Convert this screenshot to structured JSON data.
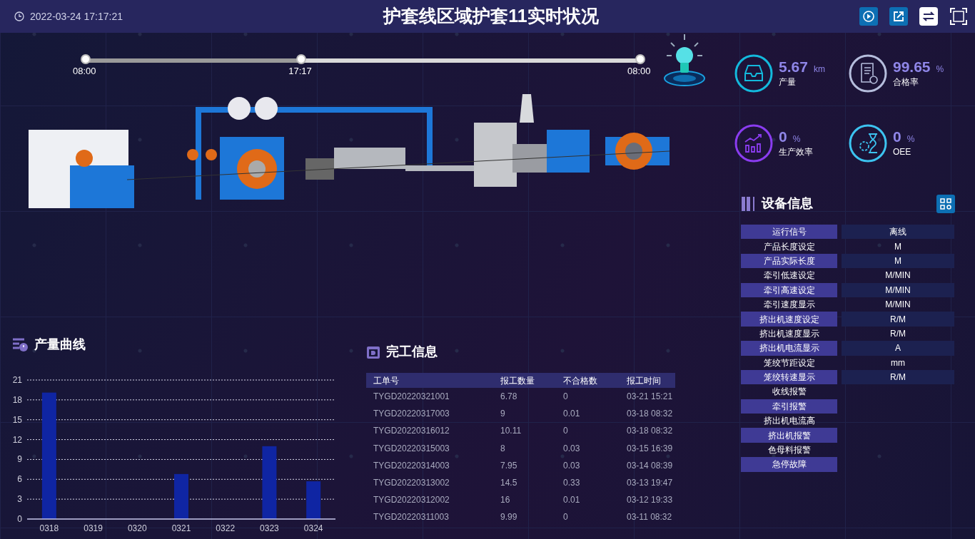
{
  "header": {
    "datetime": "2022-03-24 17:17:21",
    "title": "护套线区域护套11实时状况"
  },
  "timeline": {
    "start": "08:00",
    "current": "17:17",
    "end": "08:00",
    "level": 0.389
  },
  "kpis": [
    {
      "kind": "output",
      "value": "5.67",
      "unit": "km",
      "label": "产量"
    },
    {
      "kind": "quality",
      "value": "99.65",
      "unit": "%",
      "label": "合格率"
    },
    {
      "kind": "efficiency",
      "value": "0",
      "unit": "%",
      "label": "生产效率"
    },
    {
      "kind": "oee",
      "value": "0",
      "unit": "%",
      "label": "OEE"
    }
  ],
  "device_info": {
    "title": "设备信息",
    "rows": [
      {
        "label": "运行信号",
        "value": "离线"
      },
      {
        "label": "产品长度设定",
        "value": "M"
      },
      {
        "label": "产品实际长度",
        "value": "M"
      },
      {
        "label": "牵引低速设定",
        "value": "M/MIN"
      },
      {
        "label": "牵引高速设定",
        "value": "M/MIN"
      },
      {
        "label": "牵引速度显示",
        "value": "M/MIN"
      },
      {
        "label": "挤出机速度设定",
        "value": "R/M"
      },
      {
        "label": "挤出机速度显示",
        "value": "R/M"
      },
      {
        "label": "挤出机电流显示",
        "value": "A"
      },
      {
        "label": "笼绞节距设定",
        "value": "mm"
      },
      {
        "label": "笼绞转速显示",
        "value": "R/M"
      },
      {
        "label": "收线报警"
      },
      {
        "label": "牵引报警"
      },
      {
        "label": "挤出机电流高"
      },
      {
        "label": "挤出机报警"
      },
      {
        "label": "色母料报警"
      },
      {
        "label": "急停故障"
      }
    ]
  },
  "output_chart": {
    "title": "产量曲线",
    "chart_data": {
      "type": "bar",
      "categories": [
        "0318",
        "0319",
        "0320",
        "0321",
        "0322",
        "0323",
        "0324"
      ],
      "series": [
        {
          "color": "#0f25a3",
          "values": [
            19.1,
            0,
            0,
            6.8,
            0,
            11,
            5.7
          ]
        }
      ],
      "ylim": [
        0,
        21
      ],
      "grid": true,
      "yticks": [
        0,
        3,
        6,
        9,
        12,
        15,
        18,
        21
      ]
    }
  },
  "completion": {
    "title": "完工信息",
    "columns": [
      "工单号",
      "报工数量",
      "不合格数",
      "报工时间"
    ],
    "rows": [
      [
        "TYGD20220321001",
        "6.78",
        "0",
        "03-21 15:21"
      ],
      [
        "TYGD20220317003",
        "9",
        "0.01",
        "03-18 08:32"
      ],
      [
        "TYGD20220316012",
        "10.11",
        "0",
        "03-18 08:32"
      ],
      [
        "TYGD20220315003",
        "8",
        "0.03",
        "03-15 16:39"
      ],
      [
        "TYGD20220314003",
        "7.95",
        "0.03",
        "03-14 08:39"
      ],
      [
        "TYGD20220313002",
        "14.5",
        "0.33",
        "03-13 19:47"
      ],
      [
        "TYGD20220312002",
        "16",
        "0.01",
        "03-12 19:33"
      ],
      [
        "TYGD20220311003",
        "9.99",
        "0",
        "03-11 08:32"
      ]
    ]
  }
}
